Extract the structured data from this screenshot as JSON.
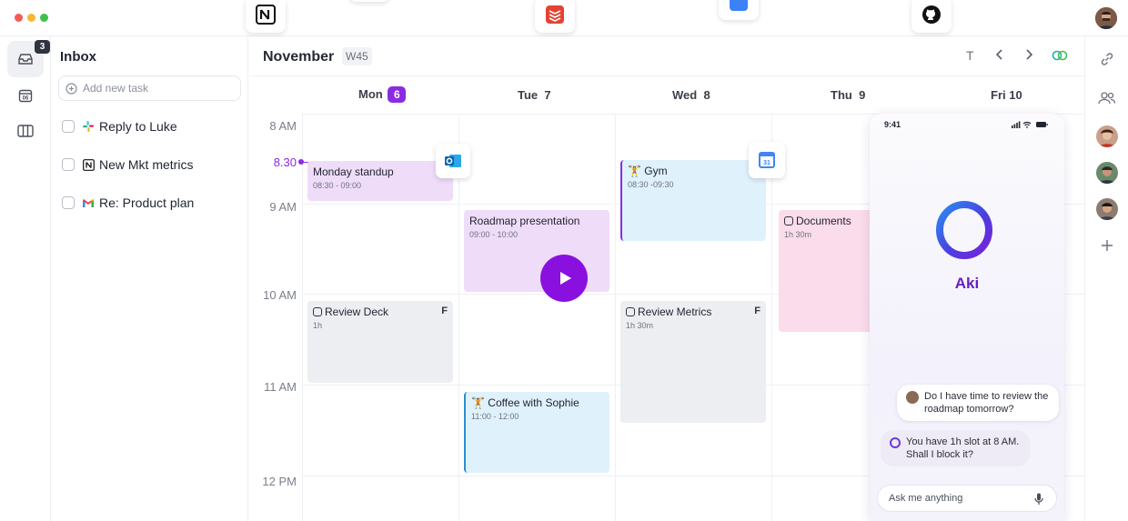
{
  "inbox": {
    "badge_count": "3",
    "title": "Inbox",
    "add_task_placeholder": "Add new task",
    "tasks": [
      {
        "label": "Reply to Luke",
        "icon": "slack-icon"
      },
      {
        "label": "New Mkt metrics",
        "icon": "notion-icon"
      },
      {
        "label": "Re: Product plan",
        "icon": "gmail-icon"
      }
    ]
  },
  "calendar": {
    "month": "November",
    "week": "W45",
    "today_button": "T",
    "days": [
      {
        "name": "Mon",
        "num": "6",
        "today": true
      },
      {
        "name": "Tue",
        "num": "7"
      },
      {
        "name": "Wed",
        "num": "8"
      },
      {
        "name": "Thu",
        "num": "9"
      },
      {
        "name": "Fri",
        "num": "10"
      }
    ],
    "times": [
      "8 AM",
      "9 AM",
      "10 AM",
      "11 AM",
      "12 PM"
    ],
    "current_time": "8.30",
    "events": {
      "monday_standup": {
        "title": "Monday standup",
        "time": "08:30 - 09:00"
      },
      "roadmap": {
        "title": "Roadmap presentation",
        "time": "09:00 - 10:00"
      },
      "gym": {
        "title": "Gym",
        "time": "08:30 -09:30"
      },
      "documents": {
        "title": "Documents",
        "time": "1h 30m"
      },
      "review_deck": {
        "title": "Review Deck",
        "time": "1h",
        "flag": "F"
      },
      "review_metrics": {
        "title": "Review Metrics",
        "time": "1h 30m",
        "flag": "F"
      },
      "coffee": {
        "title": "Coffee with Sophie",
        "time": "11:00 - 12:00"
      }
    }
  },
  "phone": {
    "status_time": "9:41",
    "assistant_name": "Aki",
    "user_message": "Do I have time to review the roadmap tomorrow?",
    "assistant_message": "You have 1h slot at 8 AM. Shall I block it?",
    "input_placeholder": "Ask me anything"
  },
  "colors": {
    "accent": "#8a2be2",
    "purple_event": "#efdcf8",
    "blue_event": "#dff1fb",
    "gray_event": "#eceef1",
    "pink_event": "#fbdcea"
  }
}
